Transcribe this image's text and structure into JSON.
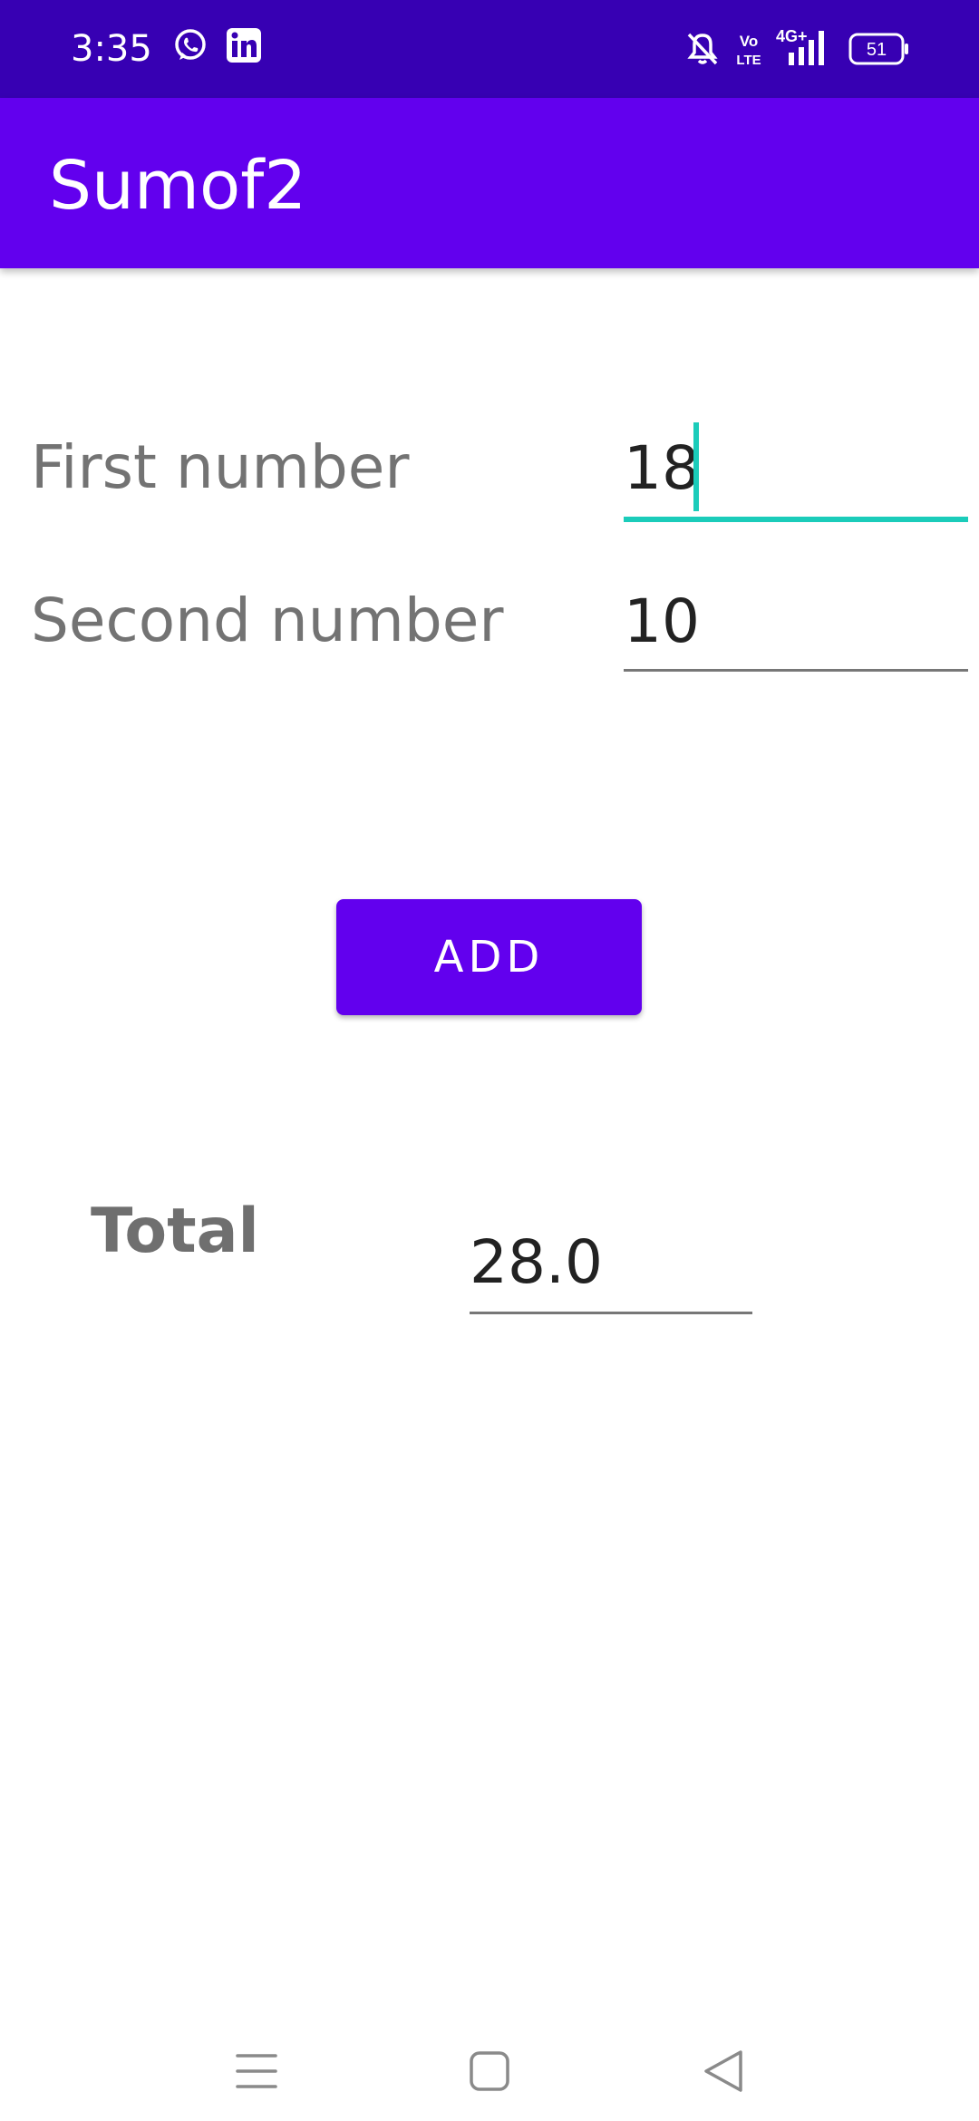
{
  "status_bar": {
    "time": "3:35",
    "battery_level": "51",
    "network_label": "4G+",
    "volte_label": "Vo LTE",
    "icons": [
      "whatsapp-icon",
      "linkedin-icon",
      "bell-muted-icon",
      "volte-icon",
      "signal-icon",
      "battery-icon"
    ]
  },
  "app_bar": {
    "title": "Sumof2"
  },
  "form": {
    "first_label": "First number",
    "first_value": "18",
    "second_label": "Second number",
    "second_value": "10",
    "add_button": "ADD",
    "total_label": "Total",
    "total_value": "28.0"
  },
  "colors": {
    "status_bar": "#3700B3",
    "primary": "#6200EE",
    "focus_accent": "#1BCCBA",
    "label_text": "#737373"
  },
  "nav_bar": {
    "buttons": [
      "menu-icon",
      "home-icon",
      "back-icon"
    ]
  }
}
